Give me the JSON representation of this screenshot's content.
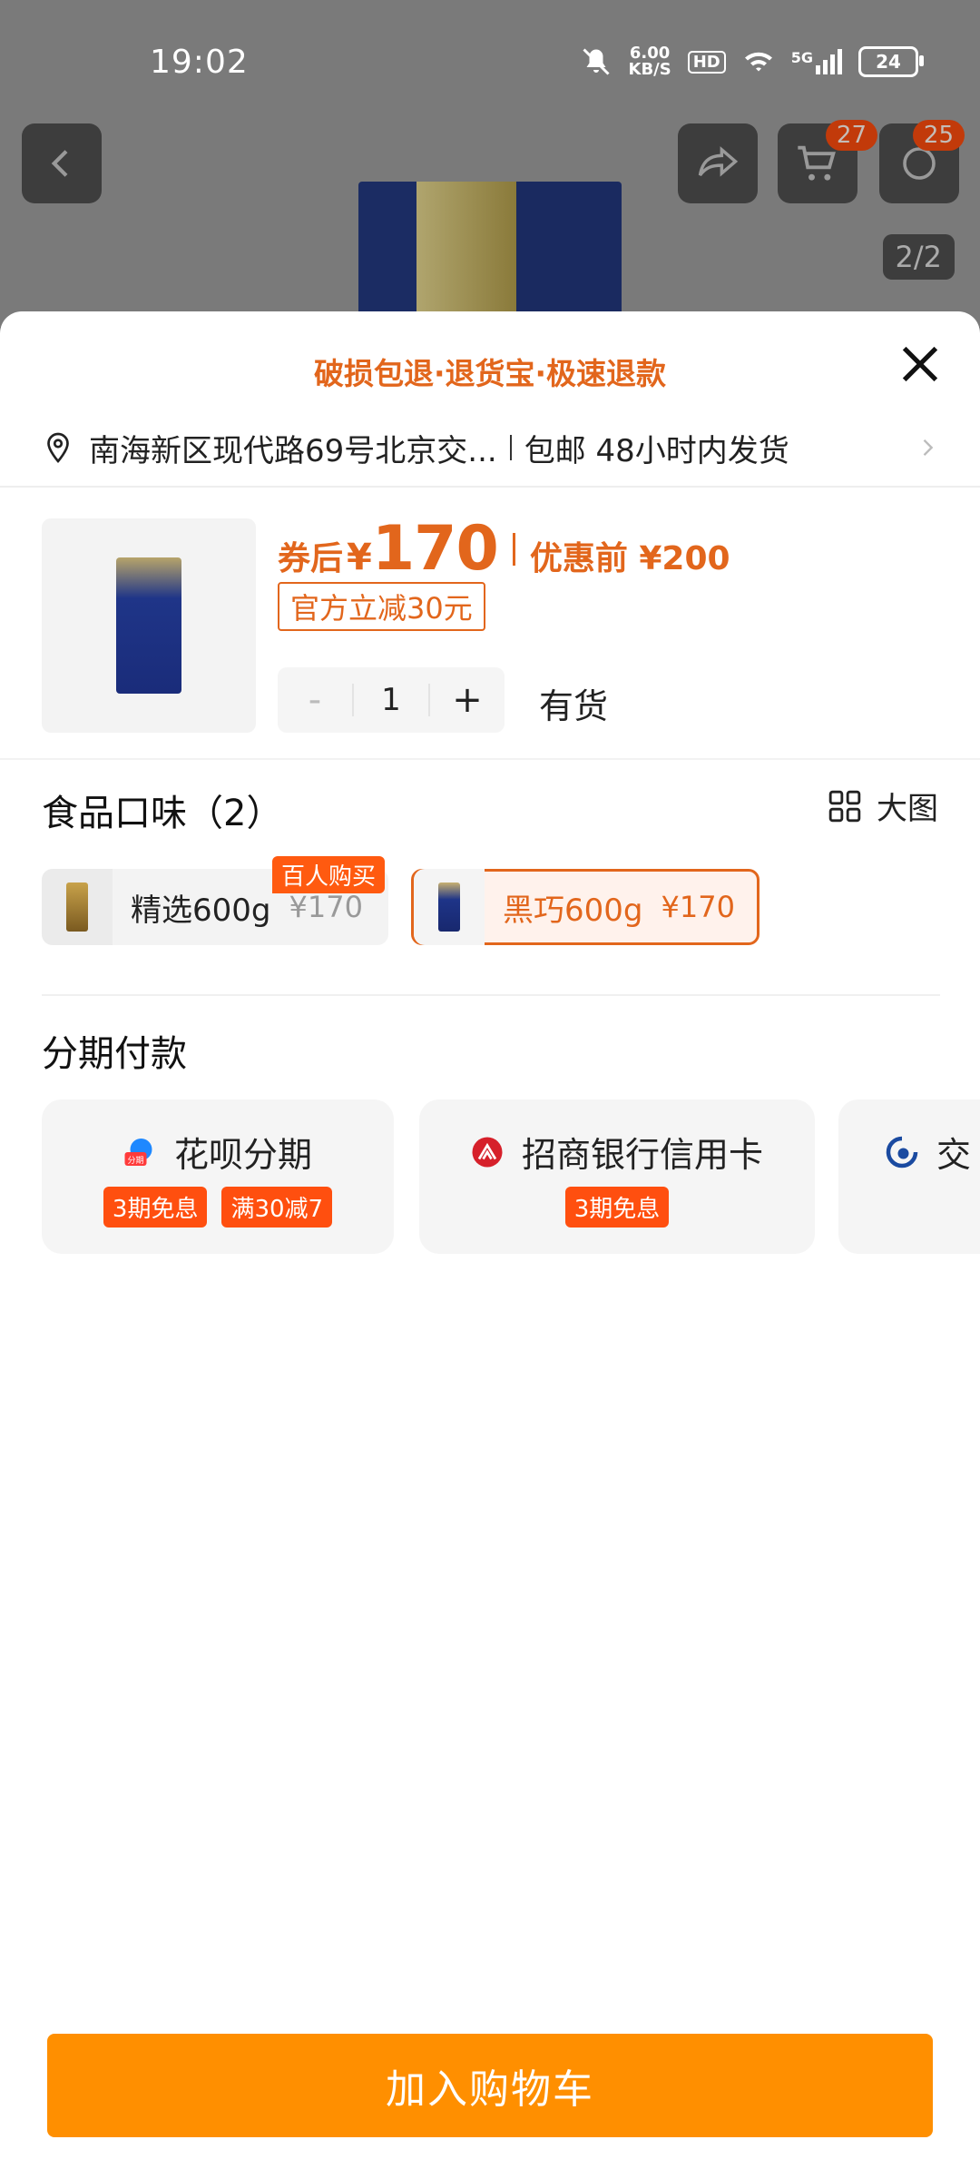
{
  "status_bar": {
    "time": "19:02",
    "net_speed_top": "6.00",
    "net_speed_unit": "KB/S",
    "hd": "HD",
    "signal": "5G",
    "battery": "24"
  },
  "page_nav": {
    "cart_badge": "27",
    "message_badge": "25",
    "pager": "2/2"
  },
  "sheet": {
    "promo": "破损包退·退货宝·极速退款",
    "address": "南海新区现代路69号北京交...",
    "shipping": "包邮 48小时内发货",
    "price_label": "券后",
    "currency": "¥",
    "price": "170",
    "before_label": "优惠前 ¥200",
    "coupon": "官方立减30元",
    "qty_minus": "-",
    "qty": "1",
    "qty_plus": "+",
    "stock": "有货",
    "flavor_title": "食品口味（2）",
    "big_pic": "大图",
    "flavors": [
      {
        "name": "精选600g",
        "price": "¥170",
        "tag": "百人购买"
      },
      {
        "name": "黑巧600g",
        "price": "¥170"
      }
    ],
    "installment_title": "分期付款",
    "payments": [
      {
        "name": "花呗分期",
        "icon_text": "分期",
        "tags": [
          "3期免息",
          "满30减7"
        ]
      },
      {
        "name": "招商银行信用卡",
        "tags": [
          "3期免息"
        ]
      },
      {
        "name": "交"
      }
    ],
    "add_to_cart": "加入购物车"
  },
  "colors": {
    "accent": "#e2661c",
    "cta": "#ff8f00",
    "tag": "#ff4f0f"
  }
}
